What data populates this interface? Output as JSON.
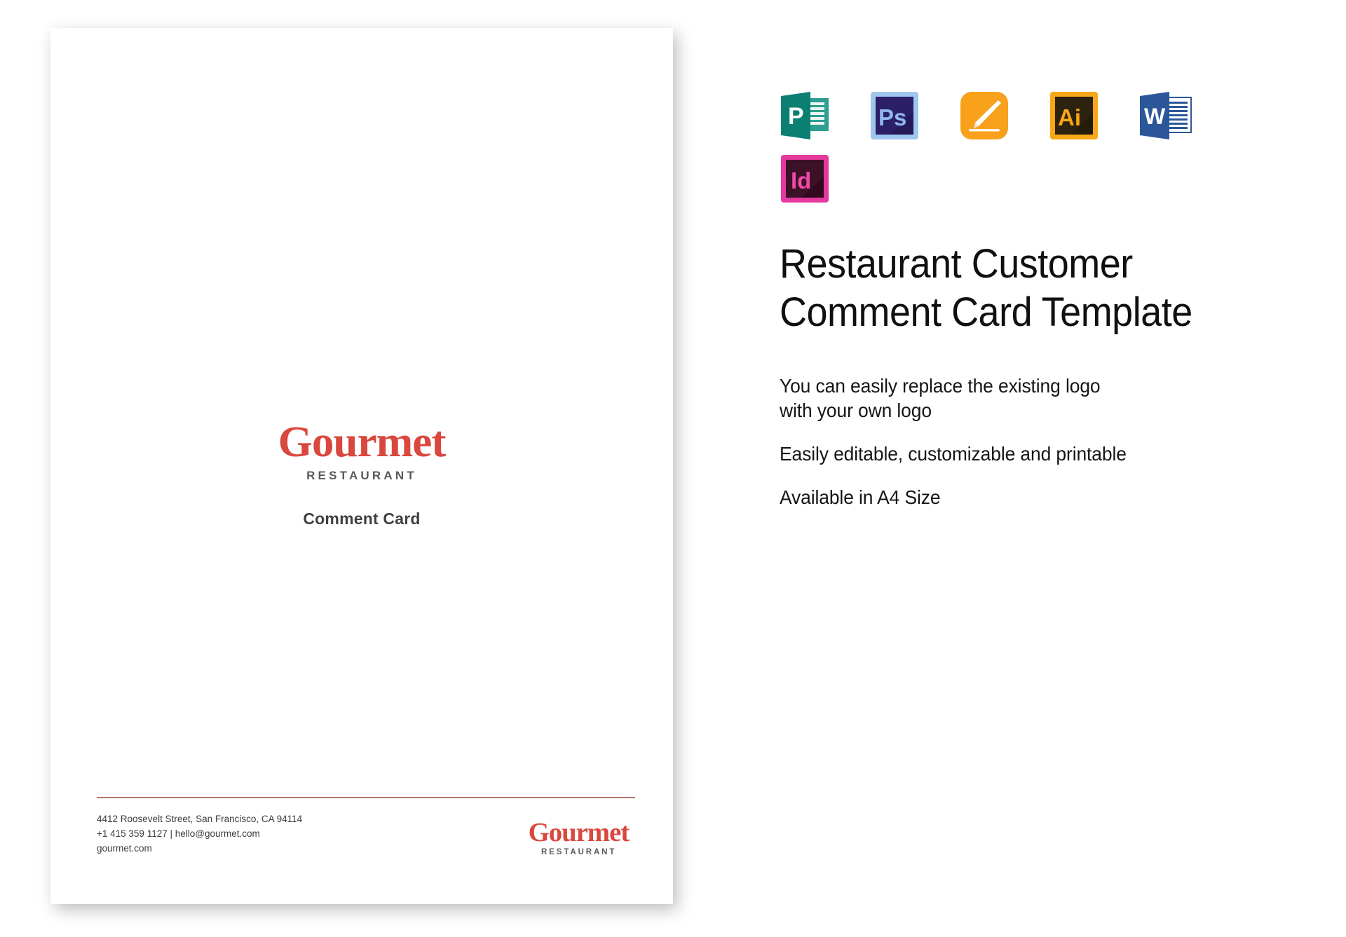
{
  "document_preview": {
    "logo": {
      "name": "Gourmet",
      "subtitle": "RESTAURANT",
      "color": "#d9483f"
    },
    "card_title": "Comment Card",
    "footer": {
      "address_line1": "4412 Roosevelt Street, San Francisco, CA 94114",
      "address_line2": "+1 415 359 1127 | hello@gourmet.com",
      "address_line3": "gourmet.com",
      "logo_name": "Gourmet",
      "logo_subtitle": "RESTAURANT",
      "rule_color": "#b5706a"
    }
  },
  "info": {
    "title": "Restaurant Customer Comment Card Template",
    "features": [
      "You can easily replace the existing logo with your own logo",
      "Easily editable, customizable and printable",
      "Available in A4 Size"
    ],
    "app_icons": [
      {
        "id": "publisher",
        "label": "P",
        "name": "ms-publisher-icon"
      },
      {
        "id": "photoshop",
        "label": "Ps",
        "name": "adobe-photoshop-icon"
      },
      {
        "id": "pages",
        "label": "",
        "name": "apple-pages-icon"
      },
      {
        "id": "illustrator",
        "label": "Ai",
        "name": "adobe-illustrator-icon"
      },
      {
        "id": "word",
        "label": "W",
        "name": "ms-word-icon"
      },
      {
        "id": "indesign",
        "label": "Id",
        "name": "adobe-indesign-icon"
      }
    ]
  }
}
